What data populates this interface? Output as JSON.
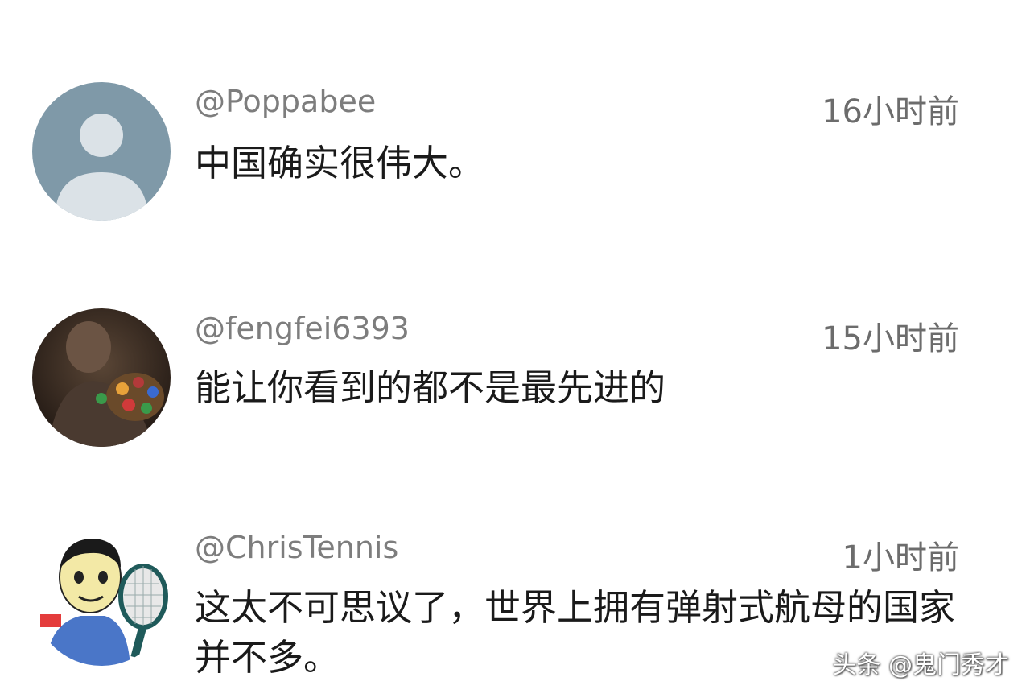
{
  "comments": [
    {
      "username": "@Poppabee",
      "time": "16小时前",
      "text": "中国确实很伟大。",
      "avatar_icon": "default-user-icon",
      "avatar_color": "#7f99a8"
    },
    {
      "username": "@fengfei6393",
      "time": "15小时前",
      "text": "能让你看到的都不是最先进的",
      "avatar_icon": "superhero-gauntlet-photo",
      "avatar_color": "#3a2a22"
    },
    {
      "username": "@ChrisTennis",
      "time": "1小时前",
      "text": "这太不可思议了，世界上拥有弹射式航母的国家并不多。",
      "avatar_icon": "cartoon-tennis-player-icon",
      "avatar_color": "#ffffff"
    }
  ],
  "watermark": "头条 @鬼门秀才"
}
